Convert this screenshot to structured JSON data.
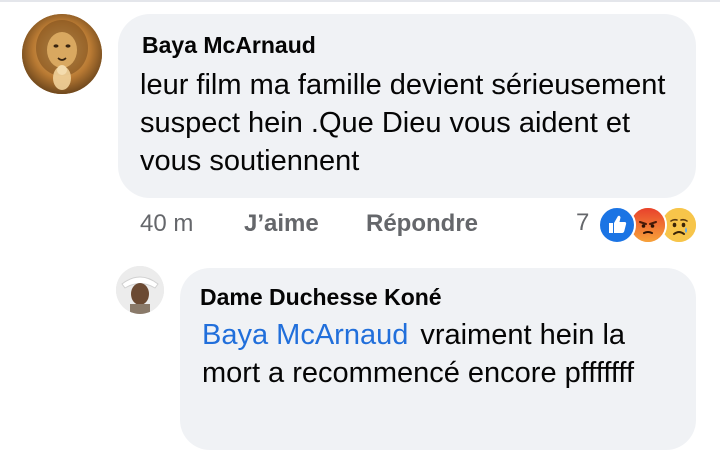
{
  "comment": {
    "author": "Baya McArnaud",
    "text": "leur film ma famille devient sérieusement suspect hein .Que Dieu vous aident et vous soutiennent",
    "time": "40 m",
    "like_label": "J’aime",
    "reply_label": "Répondre",
    "reaction_count": "7",
    "reaction_icons": [
      "like-icon",
      "angry-reaction-icon",
      "sad-reaction-icon"
    ]
  },
  "reply": {
    "author": "Dame Duchesse Koné",
    "mention": "Baya McArnaud",
    "text": "vraiment hein la mort a recommencé encore pfffffff"
  },
  "colors": {
    "bubble": "#f0f2f5",
    "mention": "#216fdb",
    "secondary_text": "#65676b",
    "like_blue": "#1b74e4"
  }
}
